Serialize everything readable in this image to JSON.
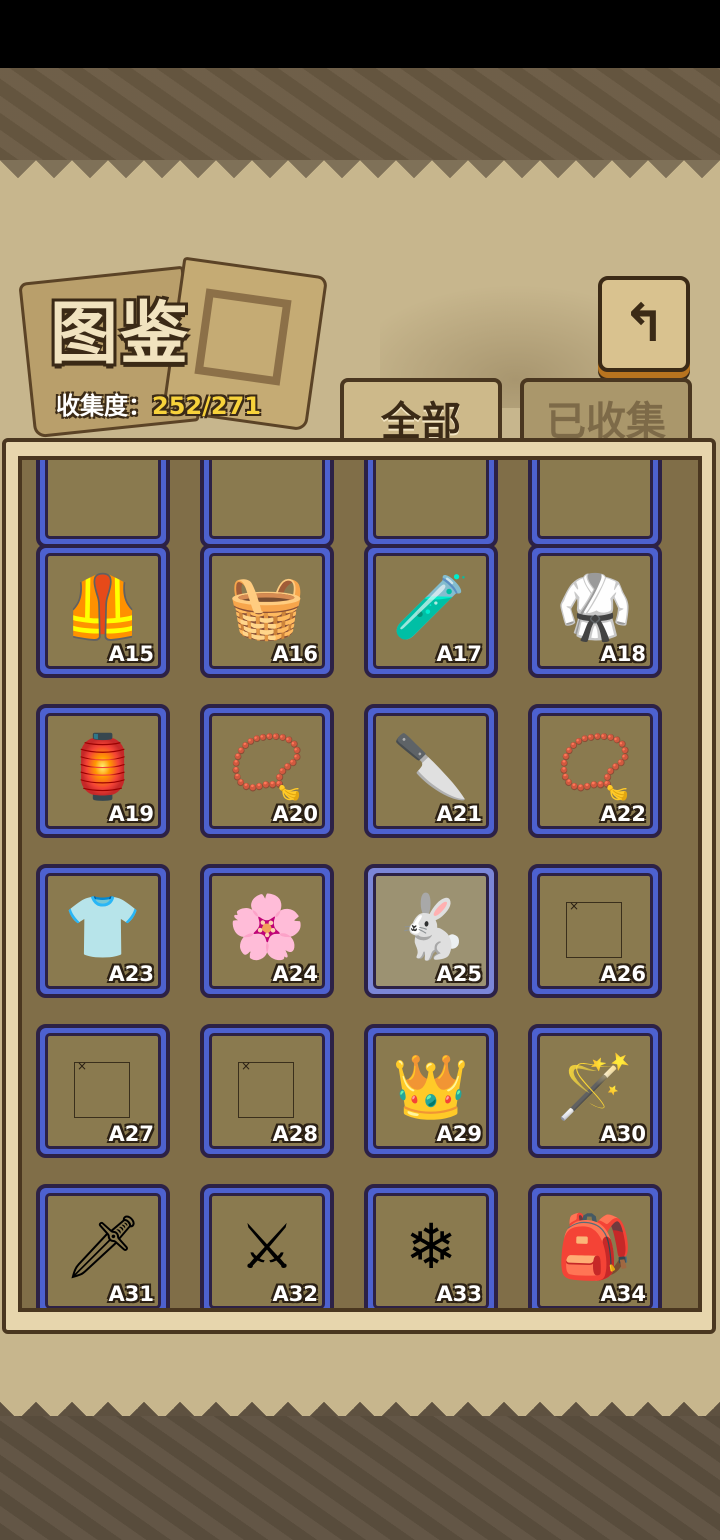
{
  "title": "图鉴",
  "collection": {
    "label": "收集度：",
    "value": "252/271"
  },
  "back_button": {
    "icon": "return-arrow-icon",
    "glyph": "↰"
  },
  "tabs": [
    {
      "label": "全部",
      "active": true
    },
    {
      "label": "已收集",
      "active": false
    }
  ],
  "items": [
    {
      "code": "",
      "icon": ""
    },
    {
      "code": "",
      "icon": ""
    },
    {
      "code": "",
      "icon": ""
    },
    {
      "code": "",
      "icon": ""
    },
    {
      "code": "A15",
      "icon": "🦺",
      "name": "leather-armor-icon"
    },
    {
      "code": "A16",
      "icon": "🧺",
      "name": "basket-icon"
    },
    {
      "code": "A17",
      "icon": "🧪",
      "name": "potion-bottle-icon"
    },
    {
      "code": "A18",
      "icon": "🥋",
      "name": "dark-vest-icon"
    },
    {
      "code": "A19",
      "icon": "🏮",
      "name": "lantern-icon"
    },
    {
      "code": "A20",
      "icon": "📿",
      "name": "gold-necklace-icon"
    },
    {
      "code": "A21",
      "icon": "🔪",
      "name": "curved-knife-icon"
    },
    {
      "code": "A22",
      "icon": "📿",
      "name": "beaded-necklace-icon"
    },
    {
      "code": "A23",
      "icon": "👕",
      "name": "sweater-icon"
    },
    {
      "code": "A24",
      "icon": "🌸",
      "name": "pompom-icon"
    },
    {
      "code": "A25",
      "icon": "🐇",
      "name": "rabbit-foot-icon",
      "highlight": true
    },
    {
      "code": "A26",
      "icon": "",
      "name": "missing-image-icon",
      "broken": true
    },
    {
      "code": "A27",
      "icon": "",
      "name": "missing-image-icon",
      "broken": true
    },
    {
      "code": "A28",
      "icon": "",
      "name": "missing-image-icon",
      "broken": true
    },
    {
      "code": "A29",
      "icon": "👑",
      "name": "jeweled-crown-icon"
    },
    {
      "code": "A30",
      "icon": "🪄",
      "name": "scepter-icon"
    },
    {
      "code": "A31",
      "icon": "🗡",
      "name": "sword-icon"
    },
    {
      "code": "A32",
      "icon": "⚔",
      "name": "sabre-icon"
    },
    {
      "code": "A33",
      "icon": "❄",
      "name": "ice-crystal-icon"
    },
    {
      "code": "A34",
      "icon": "🎒",
      "name": "backpack-icon"
    }
  ]
}
